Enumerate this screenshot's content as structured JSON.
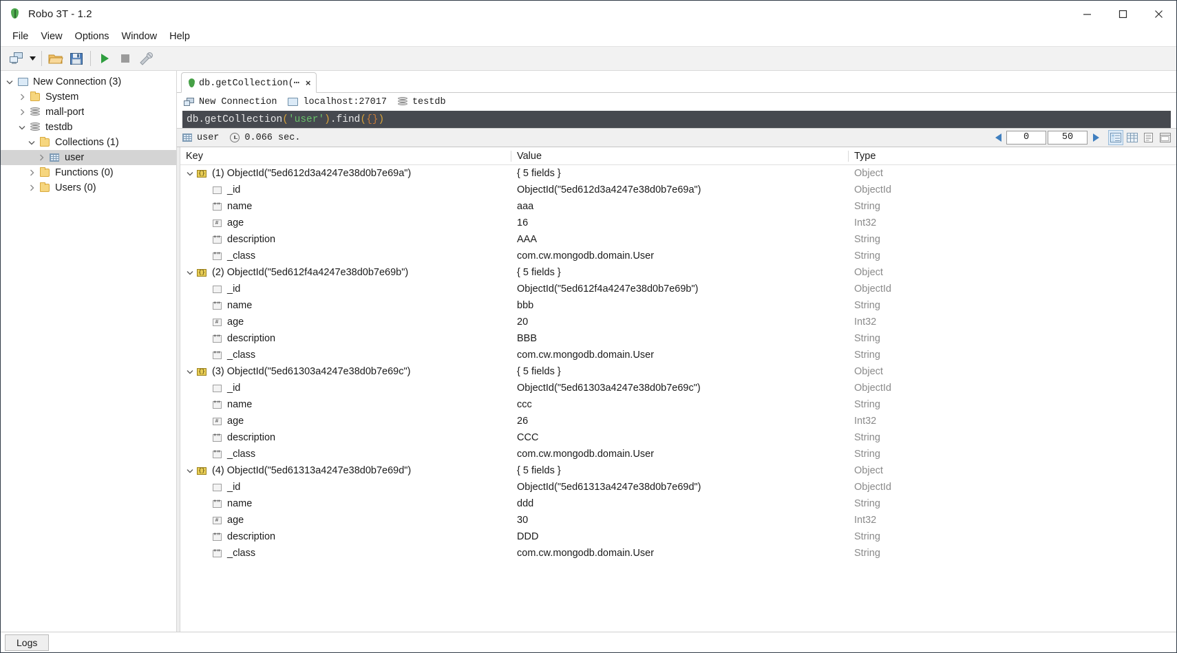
{
  "window": {
    "title": "Robo 3T - 1.2",
    "logo_icon": "mongodb-leaf-icon",
    "controls": [
      {
        "name": "minimize",
        "icon": "minimize-icon"
      },
      {
        "name": "maximize",
        "icon": "maximize-icon"
      },
      {
        "name": "close",
        "icon": "close-icon"
      }
    ]
  },
  "menubar": {
    "items": [
      {
        "label": "File"
      },
      {
        "label": "View"
      },
      {
        "label": "Options"
      },
      {
        "label": "Window"
      },
      {
        "label": "Help"
      }
    ]
  },
  "toolbar": {
    "buttons": [
      {
        "name": "connect-button",
        "icon": "connect-computers-icon"
      },
      {
        "name": "connect-dropdown",
        "icon": "caret-down-icon"
      },
      {
        "name": "open-script-button",
        "icon": "open-folder-icon"
      },
      {
        "name": "save-script-button",
        "icon": "save-floppy-icon"
      },
      {
        "name": "execute-button",
        "icon": "play-triangle-icon"
      },
      {
        "name": "stop-button",
        "icon": "stop-square-icon"
      },
      {
        "name": "refresh-button",
        "icon": "wrench-icon"
      }
    ]
  },
  "sidebar": {
    "items": [
      {
        "label": "New Connection (3)",
        "icon": "monitor-icon",
        "indent": 0,
        "expanded": true,
        "twisty": "down",
        "selected": false
      },
      {
        "label": "System",
        "icon": "folder-icon",
        "indent": 1,
        "expanded": false,
        "twisty": "right",
        "selected": false
      },
      {
        "label": "mall-port",
        "icon": "database-icon",
        "indent": 1,
        "expanded": false,
        "twisty": "right",
        "selected": false
      },
      {
        "label": "testdb",
        "icon": "database-icon",
        "indent": 1,
        "expanded": true,
        "twisty": "down",
        "selected": false
      },
      {
        "label": "Collections (1)",
        "icon": "folder-icon",
        "indent": 2,
        "expanded": true,
        "twisty": "down",
        "selected": false
      },
      {
        "label": "user",
        "icon": "collection-grid-icon",
        "indent": 3,
        "expanded": false,
        "twisty": "right",
        "selected": true
      },
      {
        "label": "Functions (0)",
        "icon": "folder-icon",
        "indent": 2,
        "expanded": false,
        "twisty": "right",
        "selected": false
      },
      {
        "label": "Users (0)",
        "icon": "folder-icon",
        "indent": 2,
        "expanded": false,
        "twisty": "right",
        "selected": false
      }
    ]
  },
  "tabs": [
    {
      "label": "db.getCollection(⋯",
      "icon": "mongodb-leaf-icon",
      "close": "×",
      "active": true
    }
  ],
  "breadcrumb": [
    {
      "label": "New Connection",
      "icon": "connection-icon"
    },
    {
      "label": "localhost:27017",
      "icon": "server-monitor-icon"
    },
    {
      "label": "testdb",
      "icon": "database-icon"
    }
  ],
  "query": {
    "full_text": "db.getCollection('user').find({})",
    "tokens": [
      {
        "text": "db.getCollection",
        "cls": "q-plain"
      },
      {
        "text": "(",
        "cls": "q-paren"
      },
      {
        "text": "'user'",
        "cls": "q-str"
      },
      {
        "text": ")",
        "cls": "q-paren"
      },
      {
        "text": ".find",
        "cls": "q-plain"
      },
      {
        "text": "(",
        "cls": "q-paren"
      },
      {
        "text": "{}",
        "cls": "q-brace"
      },
      {
        "text": ")",
        "cls": "q-paren"
      }
    ]
  },
  "results_toolbar": {
    "collection_name": "user",
    "collection_icon": "collection-grid-icon",
    "time_icon": "clock-icon",
    "elapsed": "0.066 sec.",
    "prev_icon": "left-triangle-icon",
    "next_icon": "right-triangle-icon",
    "skip_value": "0",
    "limit_value": "50",
    "view_buttons": [
      {
        "name": "tree-mode-button",
        "icon": "tree-view-icon",
        "active": true
      },
      {
        "name": "table-mode-button",
        "icon": "table-view-icon",
        "active": false
      },
      {
        "name": "text-mode-button",
        "icon": "text-view-icon",
        "active": false
      },
      {
        "name": "maximize-results-button",
        "icon": "expand-panel-icon",
        "active": false
      }
    ]
  },
  "grid": {
    "columns": [
      "Key",
      "Value",
      "Type"
    ],
    "rows": [
      {
        "indent": 0,
        "twisty": "down",
        "icon": "object-braces-icon",
        "key": "(1) ObjectId(\"5ed612d3a4247e38d0b7e69a\")",
        "value": "{ 5 fields }",
        "type": "Object"
      },
      {
        "indent": 1,
        "twisty": "",
        "icon": "objectid-icon",
        "key": "_id",
        "value": "ObjectId(\"5ed612d3a4247e38d0b7e69a\")",
        "type": "ObjectId"
      },
      {
        "indent": 1,
        "twisty": "",
        "icon": "string-quotes-icon",
        "key": "name",
        "value": "aaa",
        "type": "String"
      },
      {
        "indent": 1,
        "twisty": "",
        "icon": "integer-hash-icon",
        "key": "age",
        "value": "16",
        "type": "Int32"
      },
      {
        "indent": 1,
        "twisty": "",
        "icon": "string-quotes-icon",
        "key": "description",
        "value": "AAA",
        "type": "String"
      },
      {
        "indent": 1,
        "twisty": "",
        "icon": "string-quotes-icon",
        "key": "_class",
        "value": "com.cw.mongodb.domain.User",
        "type": "String"
      },
      {
        "indent": 0,
        "twisty": "down",
        "icon": "object-braces-icon",
        "key": "(2) ObjectId(\"5ed612f4a4247e38d0b7e69b\")",
        "value": "{ 5 fields }",
        "type": "Object"
      },
      {
        "indent": 1,
        "twisty": "",
        "icon": "objectid-icon",
        "key": "_id",
        "value": "ObjectId(\"5ed612f4a4247e38d0b7e69b\")",
        "type": "ObjectId"
      },
      {
        "indent": 1,
        "twisty": "",
        "icon": "string-quotes-icon",
        "key": "name",
        "value": "bbb",
        "type": "String"
      },
      {
        "indent": 1,
        "twisty": "",
        "icon": "integer-hash-icon",
        "key": "age",
        "value": "20",
        "type": "Int32"
      },
      {
        "indent": 1,
        "twisty": "",
        "icon": "string-quotes-icon",
        "key": "description",
        "value": "BBB",
        "type": "String"
      },
      {
        "indent": 1,
        "twisty": "",
        "icon": "string-quotes-icon",
        "key": "_class",
        "value": "com.cw.mongodb.domain.User",
        "type": "String"
      },
      {
        "indent": 0,
        "twisty": "down",
        "icon": "object-braces-icon",
        "key": "(3) ObjectId(\"5ed61303a4247e38d0b7e69c\")",
        "value": "{ 5 fields }",
        "type": "Object"
      },
      {
        "indent": 1,
        "twisty": "",
        "icon": "objectid-icon",
        "key": "_id",
        "value": "ObjectId(\"5ed61303a4247e38d0b7e69c\")",
        "type": "ObjectId"
      },
      {
        "indent": 1,
        "twisty": "",
        "icon": "string-quotes-icon",
        "key": "name",
        "value": "ccc",
        "type": "String"
      },
      {
        "indent": 1,
        "twisty": "",
        "icon": "integer-hash-icon",
        "key": "age",
        "value": "26",
        "type": "Int32"
      },
      {
        "indent": 1,
        "twisty": "",
        "icon": "string-quotes-icon",
        "key": "description",
        "value": "CCC",
        "type": "String"
      },
      {
        "indent": 1,
        "twisty": "",
        "icon": "string-quotes-icon",
        "key": "_class",
        "value": "com.cw.mongodb.domain.User",
        "type": "String"
      },
      {
        "indent": 0,
        "twisty": "down",
        "icon": "object-braces-icon",
        "key": "(4) ObjectId(\"5ed61313a4247e38d0b7e69d\")",
        "value": "{ 5 fields }",
        "type": "Object"
      },
      {
        "indent": 1,
        "twisty": "",
        "icon": "objectid-icon",
        "key": "_id",
        "value": "ObjectId(\"5ed61313a4247e38d0b7e69d\")",
        "type": "ObjectId"
      },
      {
        "indent": 1,
        "twisty": "",
        "icon": "string-quotes-icon",
        "key": "name",
        "value": "ddd",
        "type": "String"
      },
      {
        "indent": 1,
        "twisty": "",
        "icon": "integer-hash-icon",
        "key": "age",
        "value": "30",
        "type": "Int32"
      },
      {
        "indent": 1,
        "twisty": "",
        "icon": "string-quotes-icon",
        "key": "description",
        "value": "DDD",
        "type": "String"
      },
      {
        "indent": 1,
        "twisty": "",
        "icon": "string-quotes-icon",
        "key": "_class",
        "value": "com.cw.mongodb.domain.User",
        "type": "String"
      }
    ]
  },
  "statusbar": {
    "logs_label": "Logs"
  },
  "colors": {
    "accent_green": "#46a046",
    "query_bg": "#46494f",
    "string_token": "#69c16a",
    "paren_token": "#d8a33a",
    "selection": "#d4d4d4",
    "type_text": "#8a8a8a"
  }
}
